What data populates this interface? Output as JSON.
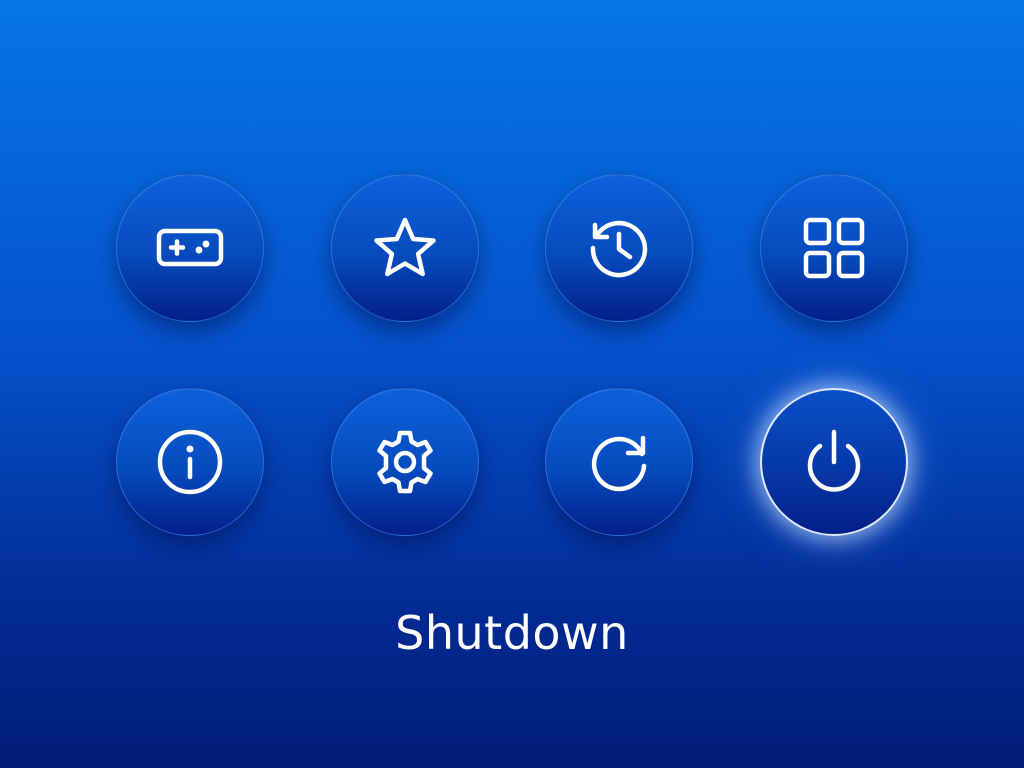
{
  "menu": {
    "tiles": [
      {
        "icon": "gamepad-icon",
        "selected": false
      },
      {
        "icon": "star-icon",
        "selected": false
      },
      {
        "icon": "history-icon",
        "selected": false
      },
      {
        "icon": "apps-grid-icon",
        "selected": false
      },
      {
        "icon": "info-icon",
        "selected": false
      },
      {
        "icon": "gear-icon",
        "selected": false
      },
      {
        "icon": "refresh-icon",
        "selected": false
      },
      {
        "icon": "power-icon",
        "selected": true
      }
    ],
    "selected_label": "Shutdown"
  },
  "colors": {
    "background_top": "#0577e3",
    "background_bottom": "#021c77",
    "icon_stroke": "#ffffff",
    "selected_ring": "#dfe9ff"
  }
}
